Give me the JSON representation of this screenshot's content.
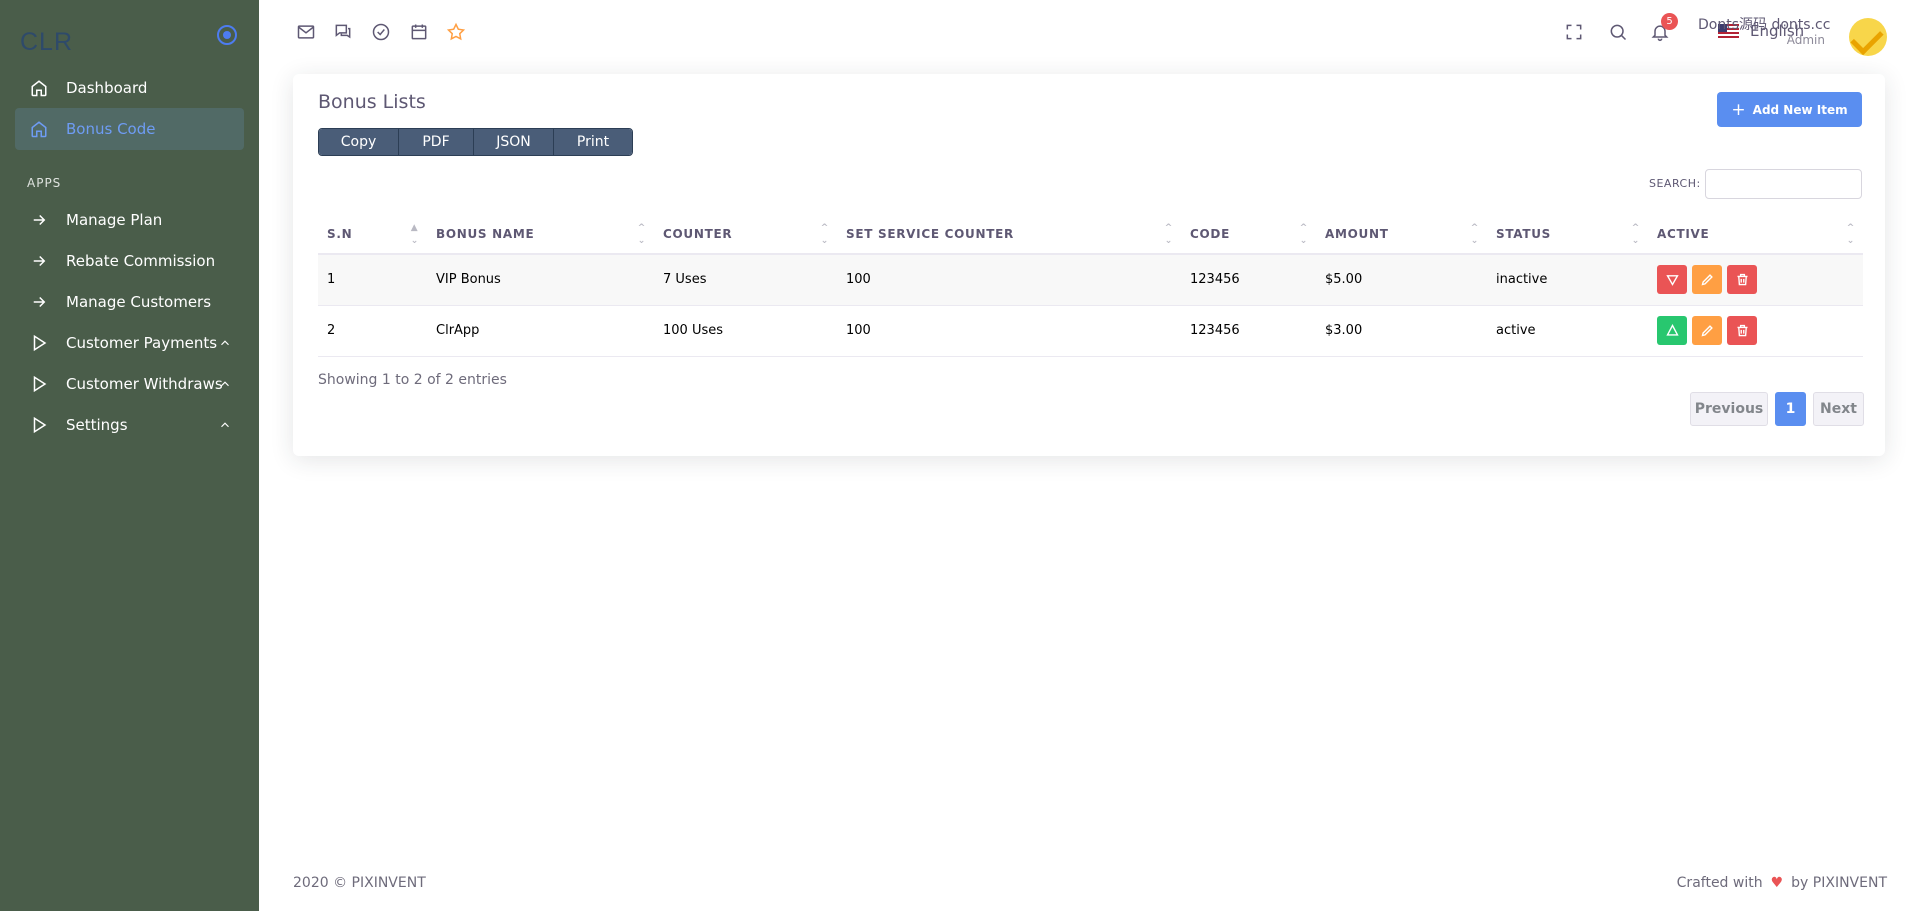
{
  "brand": "CLR",
  "sidebar": {
    "items": [
      {
        "label": "Dashboard"
      },
      {
        "label": "Bonus Code"
      }
    ],
    "section": "APPS",
    "apps": [
      {
        "label": "Manage Plan"
      },
      {
        "label": "Rebate Commission"
      },
      {
        "label": "Manage Customers"
      },
      {
        "label": "Customer Payments"
      },
      {
        "label": "Customer Withdraws"
      },
      {
        "label": "Settings"
      }
    ]
  },
  "topbar": {
    "language": "English",
    "notifications": "5",
    "user_name": "Donts源码 donts.cc",
    "user_role": "Admin"
  },
  "card": {
    "title": "Bonus Lists",
    "export_buttons": [
      "Copy",
      "PDF",
      "JSON",
      "Print"
    ],
    "add_label": "Add New Item",
    "search_label": "SEARCH:",
    "columns": [
      "S.N",
      "BONUS NAME",
      "COUNTER",
      "SET SERVICE COUNTER",
      "CODE",
      "AMOUNT",
      "STATUS",
      "ACTIVE"
    ],
    "rows": [
      {
        "sn": "1",
        "name": "VIP Bonus",
        "counter": "7 Uses",
        "service": "100",
        "code": "123456",
        "amount": "$5.00",
        "status": "inactive"
      },
      {
        "sn": "2",
        "name": "ClrApp",
        "counter": "100 Uses",
        "service": "100",
        "code": "123456",
        "amount": "$3.00",
        "status": "active"
      }
    ],
    "info": "Showing 1 to 2 of 2 entries",
    "pager": {
      "prev": "Previous",
      "current": "1",
      "next": "Next"
    }
  },
  "footer": {
    "left": "2020 © PIXINVENT",
    "right_prefix": "Crafted with",
    "right_suffix": "by PIXINVENT"
  },
  "colors": {
    "sidebar_bg": "#4a5d4a",
    "primary": "#5a8ef0",
    "danger": "#ea5455",
    "warning": "#ff9f43",
    "success": "#28c76f"
  }
}
